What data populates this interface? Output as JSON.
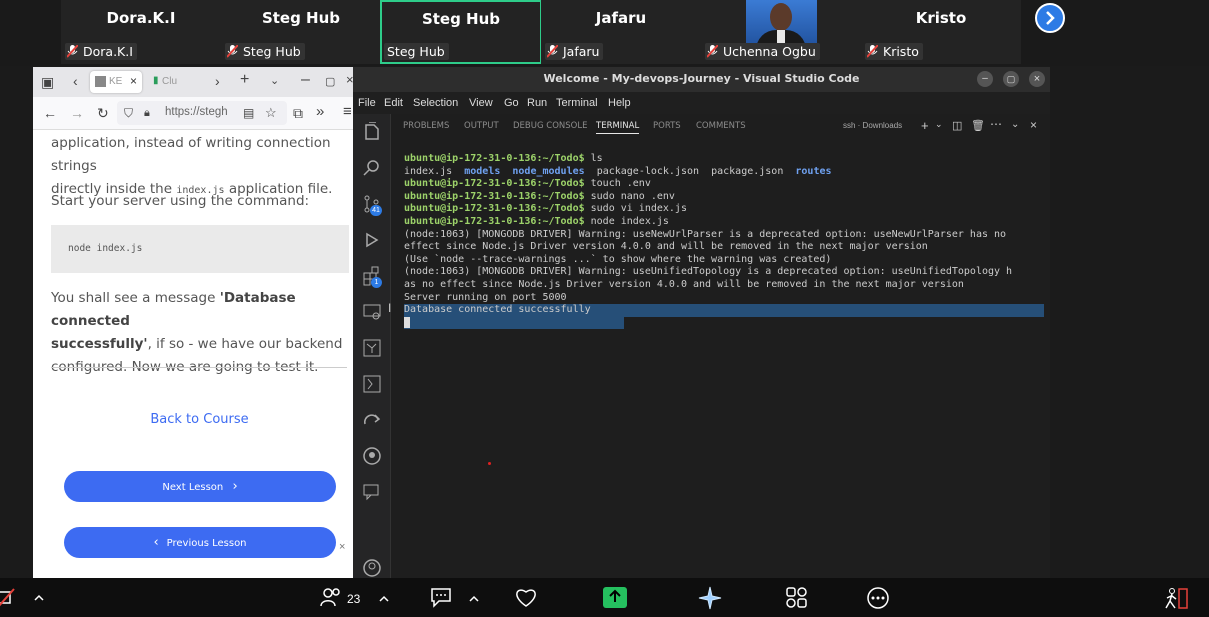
{
  "participants": [
    {
      "name": "Dora.K.I",
      "label": "Dora.K.I",
      "muted": true
    },
    {
      "name": "Steg Hub",
      "label": "Steg Hub",
      "muted": true
    },
    {
      "name": "Steg Hub",
      "label": "Steg Hub",
      "muted": false,
      "active": true
    },
    {
      "name": "Jafaru",
      "label": "Jafaru",
      "muted": true
    },
    {
      "name": "",
      "label": "Uchenna Ogbu",
      "muted": true,
      "video": true
    },
    {
      "name": "Kristo",
      "label": "Kristo",
      "muted": true
    }
  ],
  "browser": {
    "tab1_label": "KE",
    "tab2_label": "Clu",
    "url": "https://stegh",
    "para1_line1": "application, instead of writing connection strings",
    "para1_line2a": "directly inside the",
    "para1_code": "index.js",
    "para1_line2b": "application file.",
    "para2": "Start your server using the command:",
    "code": "node index.js",
    "para3_a": "You shall see a message",
    "para3_bold1": "'Database connected",
    "para3_bold2": "successfully'",
    "para3_b": ", if so - we have our backend",
    "para3_c": "configured. Now we are going to test it.",
    "back_link": "Back to Course",
    "next_button": "Next Lesson",
    "prev_button": "Previous Lesson"
  },
  "vscode": {
    "title": "Welcome - My-devops-Journey - Visual Studio Code",
    "menu": [
      "File",
      "Edit",
      "Selection",
      "View",
      "Go",
      "Run",
      "Terminal",
      "Help"
    ],
    "panel_tabs": [
      "PROBLEMS",
      "OUTPUT",
      "DEBUG CONSOLE",
      "TERMINAL",
      "PORTS",
      "COMMENTS"
    ],
    "terminal_name": "ssh · Downloads",
    "source_control_badge": "41",
    "extensions_badge": "1",
    "prompt": "ubuntu@ip-172-31-0-136:~/Todo$",
    "terminal_lines": [
      {
        "prompt": true,
        "cmd": " ls"
      },
      {
        "files": [
          "index.js",
          "models",
          "node_modules",
          "package-lock.json",
          "package.json",
          "routes"
        ]
      },
      {
        "prompt": true,
        "cmd": " touch .env"
      },
      {
        "prompt": true,
        "cmd": " sudo nano .env"
      },
      {
        "prompt": true,
        "cmd": " sudo vi index.js"
      },
      {
        "prompt": true,
        "cmd": " node index.js"
      },
      {
        "text": "(node:1063) [MONGODB DRIVER] Warning: useNewUrlParser is a deprecated option: useNewUrlParser has no"
      },
      {
        "text": "effect since Node.js Driver version 4.0.0 and will be removed in the next major version"
      },
      {
        "text": "(Use `node --trace-warnings ...` to show where the warning was created)"
      },
      {
        "text": "(node:1063) [MONGODB DRIVER] Warning: useUnifiedTopology is a deprecated option: useUnifiedTopology h"
      },
      {
        "text": "as no effect since Node.js Driver version 4.0.0 and will be removed in the next major version"
      },
      {
        "text": "Server running on port 5000"
      },
      {
        "text": "Database connected successfully",
        "selected": true
      }
    ]
  },
  "bottom_bar": {
    "participant_count": "23"
  }
}
